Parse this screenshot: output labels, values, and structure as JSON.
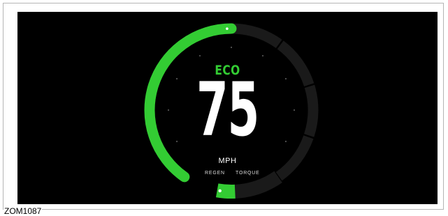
{
  "figure": {
    "code": "ZOM1087"
  },
  "gauge": {
    "drive_mode": "ECO",
    "speed_value": "75",
    "speed_unit": "MPH",
    "regen_label": "REGEN",
    "torque_label": "TORQUE",
    "power_arc_fraction": 0.5,
    "regen_torque_fraction": 0.28,
    "colors": {
      "accent": "#33cc33",
      "track": "#1a1a1a",
      "background": "#000000",
      "text": "#ffffff"
    }
  }
}
